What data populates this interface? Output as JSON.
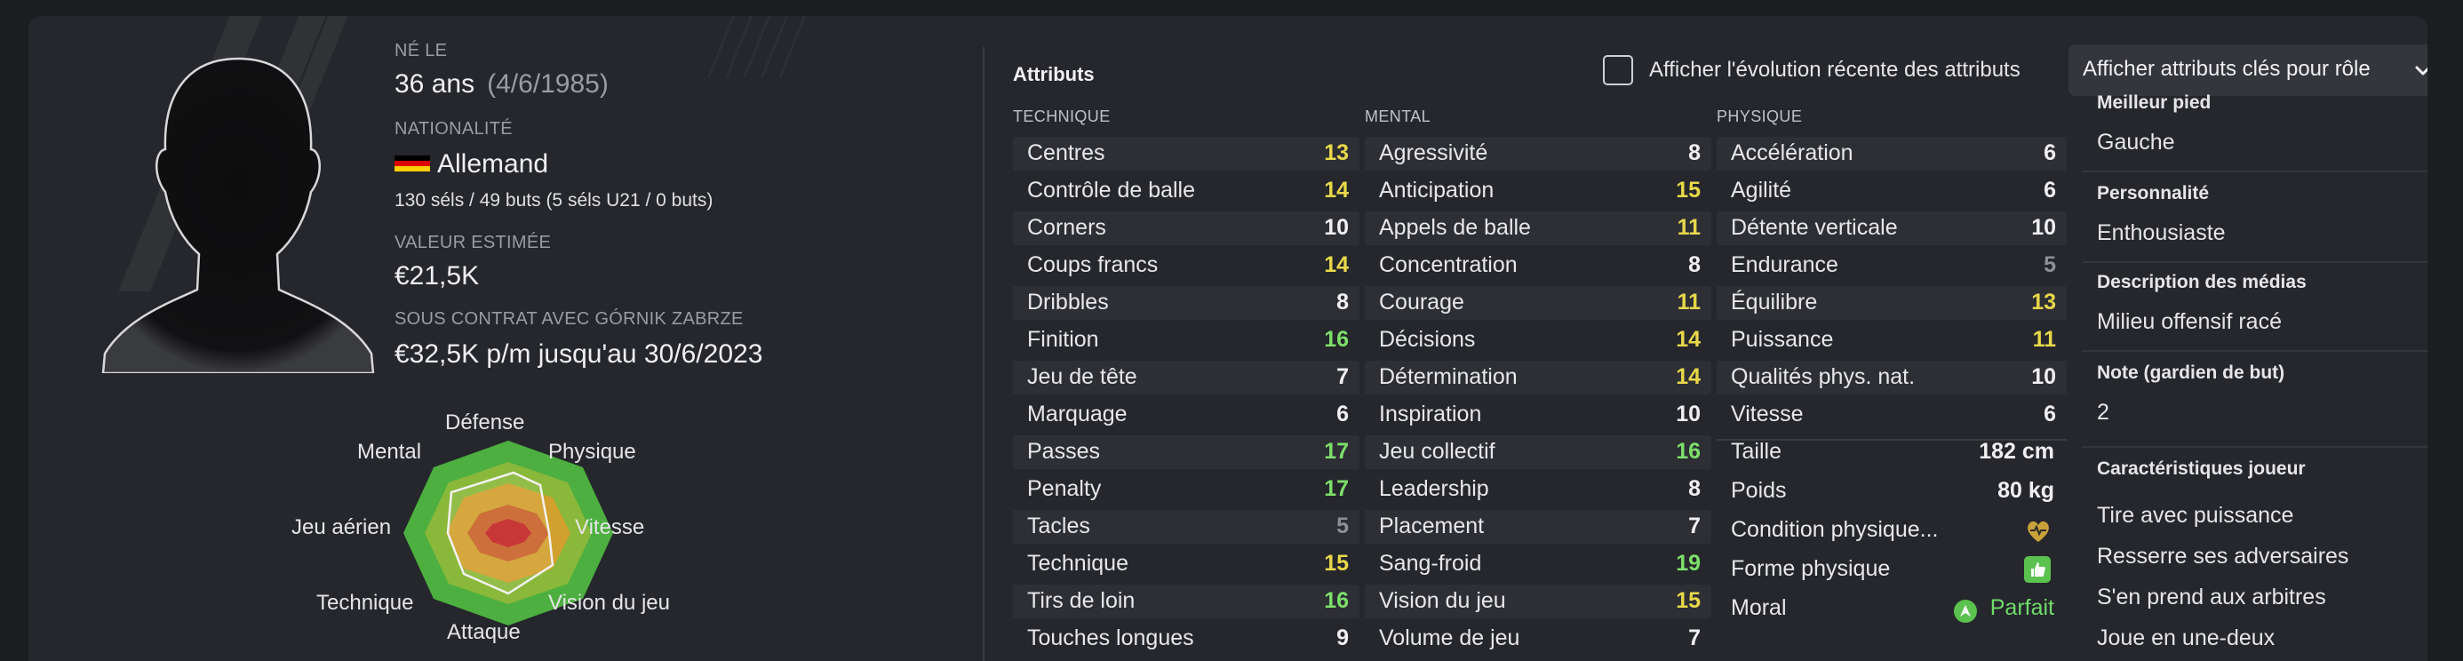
{
  "bio": {
    "born_label": "NÉ LE",
    "age": "36 ans",
    "birth_date": "(4/6/1985)",
    "nationality_label": "NATIONALITÉ",
    "nationality": "Allemand",
    "caps": "130 séls / 49 buts (5 séls U21 / 0 buts)",
    "value_label": "VALEUR ESTIMÉE",
    "value": "€21,5K",
    "contract_label": "SOUS CONTRAT AVEC GÓRNIK ZABRZE",
    "contract": "€32,5K p/m jusqu'au 30/6/2023"
  },
  "radar": {
    "labels": {
      "defense": "Défense",
      "physique": "Physique",
      "vitesse": "Vitesse",
      "vision": "Vision du jeu",
      "attaque": "Attaque",
      "technique": "Technique",
      "jeu_aerien": "Jeu aérien",
      "mental": "Mental"
    }
  },
  "attributes": {
    "title": "Attributs",
    "toggle_label": "Afficher l'évolution récente des attributs",
    "dropdown_label": "Afficher attributs clés pour rôle",
    "technique": {
      "header": "TECHNIQUE",
      "rows": [
        {
          "name": "Centres",
          "value": "13",
          "tone": "yellow"
        },
        {
          "name": "Contrôle de balle",
          "value": "14",
          "tone": "yellow"
        },
        {
          "name": "Corners",
          "value": "10",
          "tone": "white"
        },
        {
          "name": "Coups francs",
          "value": "14",
          "tone": "yellow"
        },
        {
          "name": "Dribbles",
          "value": "8",
          "tone": "white"
        },
        {
          "name": "Finition",
          "value": "16",
          "tone": "green"
        },
        {
          "name": "Jeu de tête",
          "value": "7",
          "tone": "white"
        },
        {
          "name": "Marquage",
          "value": "6",
          "tone": "white"
        },
        {
          "name": "Passes",
          "value": "17",
          "tone": "green"
        },
        {
          "name": "Penalty",
          "value": "17",
          "tone": "green"
        },
        {
          "name": "Tacles",
          "value": "5",
          "tone": "grey"
        },
        {
          "name": "Technique",
          "value": "15",
          "tone": "yellow"
        },
        {
          "name": "Tirs de loin",
          "value": "16",
          "tone": "green"
        },
        {
          "name": "Touches longues",
          "value": "9",
          "tone": "white"
        }
      ]
    },
    "mental": {
      "header": "MENTAL",
      "rows": [
        {
          "name": "Agressivité",
          "value": "8",
          "tone": "white"
        },
        {
          "name": "Anticipation",
          "value": "15",
          "tone": "yellow"
        },
        {
          "name": "Appels de balle",
          "value": "11",
          "tone": "yellow"
        },
        {
          "name": "Concentration",
          "value": "8",
          "tone": "white"
        },
        {
          "name": "Courage",
          "value": "11",
          "tone": "yellow"
        },
        {
          "name": "Décisions",
          "value": "14",
          "tone": "yellow"
        },
        {
          "name": "Détermination",
          "value": "14",
          "tone": "yellow"
        },
        {
          "name": "Inspiration",
          "value": "10",
          "tone": "white"
        },
        {
          "name": "Jeu collectif",
          "value": "16",
          "tone": "green"
        },
        {
          "name": "Leadership",
          "value": "8",
          "tone": "white"
        },
        {
          "name": "Placement",
          "value": "7",
          "tone": "white"
        },
        {
          "name": "Sang-froid",
          "value": "19",
          "tone": "green"
        },
        {
          "name": "Vision du jeu",
          "value": "15",
          "tone": "yellow"
        },
        {
          "name": "Volume de jeu",
          "value": "7",
          "tone": "white"
        }
      ]
    },
    "physique": {
      "header": "PHYSIQUE",
      "rows": [
        {
          "name": "Accélération",
          "value": "6",
          "tone": "white"
        },
        {
          "name": "Agilité",
          "value": "6",
          "tone": "white"
        },
        {
          "name": "Détente verticale",
          "value": "10",
          "tone": "white"
        },
        {
          "name": "Endurance",
          "value": "5",
          "tone": "grey"
        },
        {
          "name": "Équilibre",
          "value": "13",
          "tone": "yellow"
        },
        {
          "name": "Puissance",
          "value": "11",
          "tone": "yellow"
        },
        {
          "name": "Qualités phys. nat.",
          "value": "10",
          "tone": "white"
        },
        {
          "name": "Vitesse",
          "value": "6",
          "tone": "white"
        }
      ]
    },
    "info": {
      "height_label": "Taille",
      "height": "182 cm",
      "weight_label": "Poids",
      "weight": "80 kg",
      "condition_label": "Condition physique...",
      "fitness_label": "Forme physique",
      "morale_label": "Moral",
      "morale": "Parfait"
    }
  },
  "sidebar": {
    "foot_label": "Meilleur pied",
    "foot": "Gauche",
    "personality_label": "Personnalité",
    "personality": "Enthousiaste",
    "media_label": "Description des médias",
    "media": "Milieu offensif racé",
    "gk_label": "Note (gardien de but)",
    "gk": "2",
    "traits_label": "Caractéristiques joueur",
    "traits": [
      "Tire avec puissance",
      "Resserre ses adversaires",
      "S'en prend aux arbitres",
      "Joue en une-deux"
    ]
  },
  "colors": {
    "attr_yellow": "#e8d84a",
    "attr_green": "#7ee06a",
    "attr_grey": "#8d9097",
    "morale_green": "#6fdc6a",
    "radar_green": "#4caf3f"
  }
}
